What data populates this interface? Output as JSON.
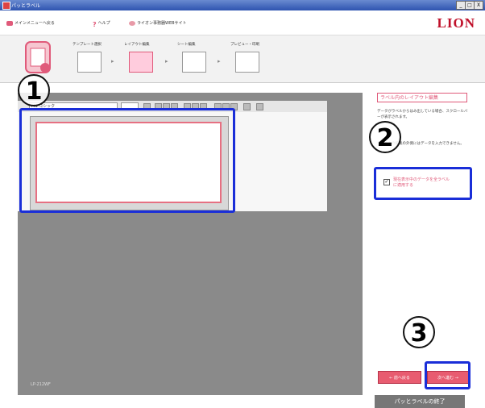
{
  "window": {
    "title": "パッとラベル",
    "minimize": "_",
    "maximize": "□",
    "close": "X"
  },
  "menu": {
    "back_main": "メインメニューへ戻る",
    "help": "ヘルプ",
    "website": "ライオン事務器WEBサイト",
    "brand": "LION"
  },
  "steps": [
    {
      "label": "テンプレート選択",
      "active": false
    },
    {
      "label": "レイアウト編集",
      "active": true
    },
    {
      "label": "シート編集",
      "active": false
    },
    {
      "label": "プレビュー・印刷",
      "active": false
    }
  ],
  "toolbar": {
    "font_combo": "MS ゴシック"
  },
  "canvas": {
    "model": "LP-212WF"
  },
  "right_panel": {
    "title": "ラベル内のレイアウト編集",
    "desc1": "データがラベルからはみ出している場合、スクロールバーが表示されます。",
    "desc2": "ラベル上の編集の外側にはデータを入力できません。",
    "apply_label": "現在表示中のデータを全ラベルに適用する",
    "apply_checked": true
  },
  "nav": {
    "prev": "← 前へ戻る",
    "next": "次へ進む →",
    "finish": "パッとラベルの終了"
  },
  "callouts": {
    "one": "1",
    "two": "2",
    "three": "3"
  },
  "colors": {
    "accent": "#e05a7a",
    "highlight": "#1a2ed8",
    "brand": "#c0102a"
  }
}
